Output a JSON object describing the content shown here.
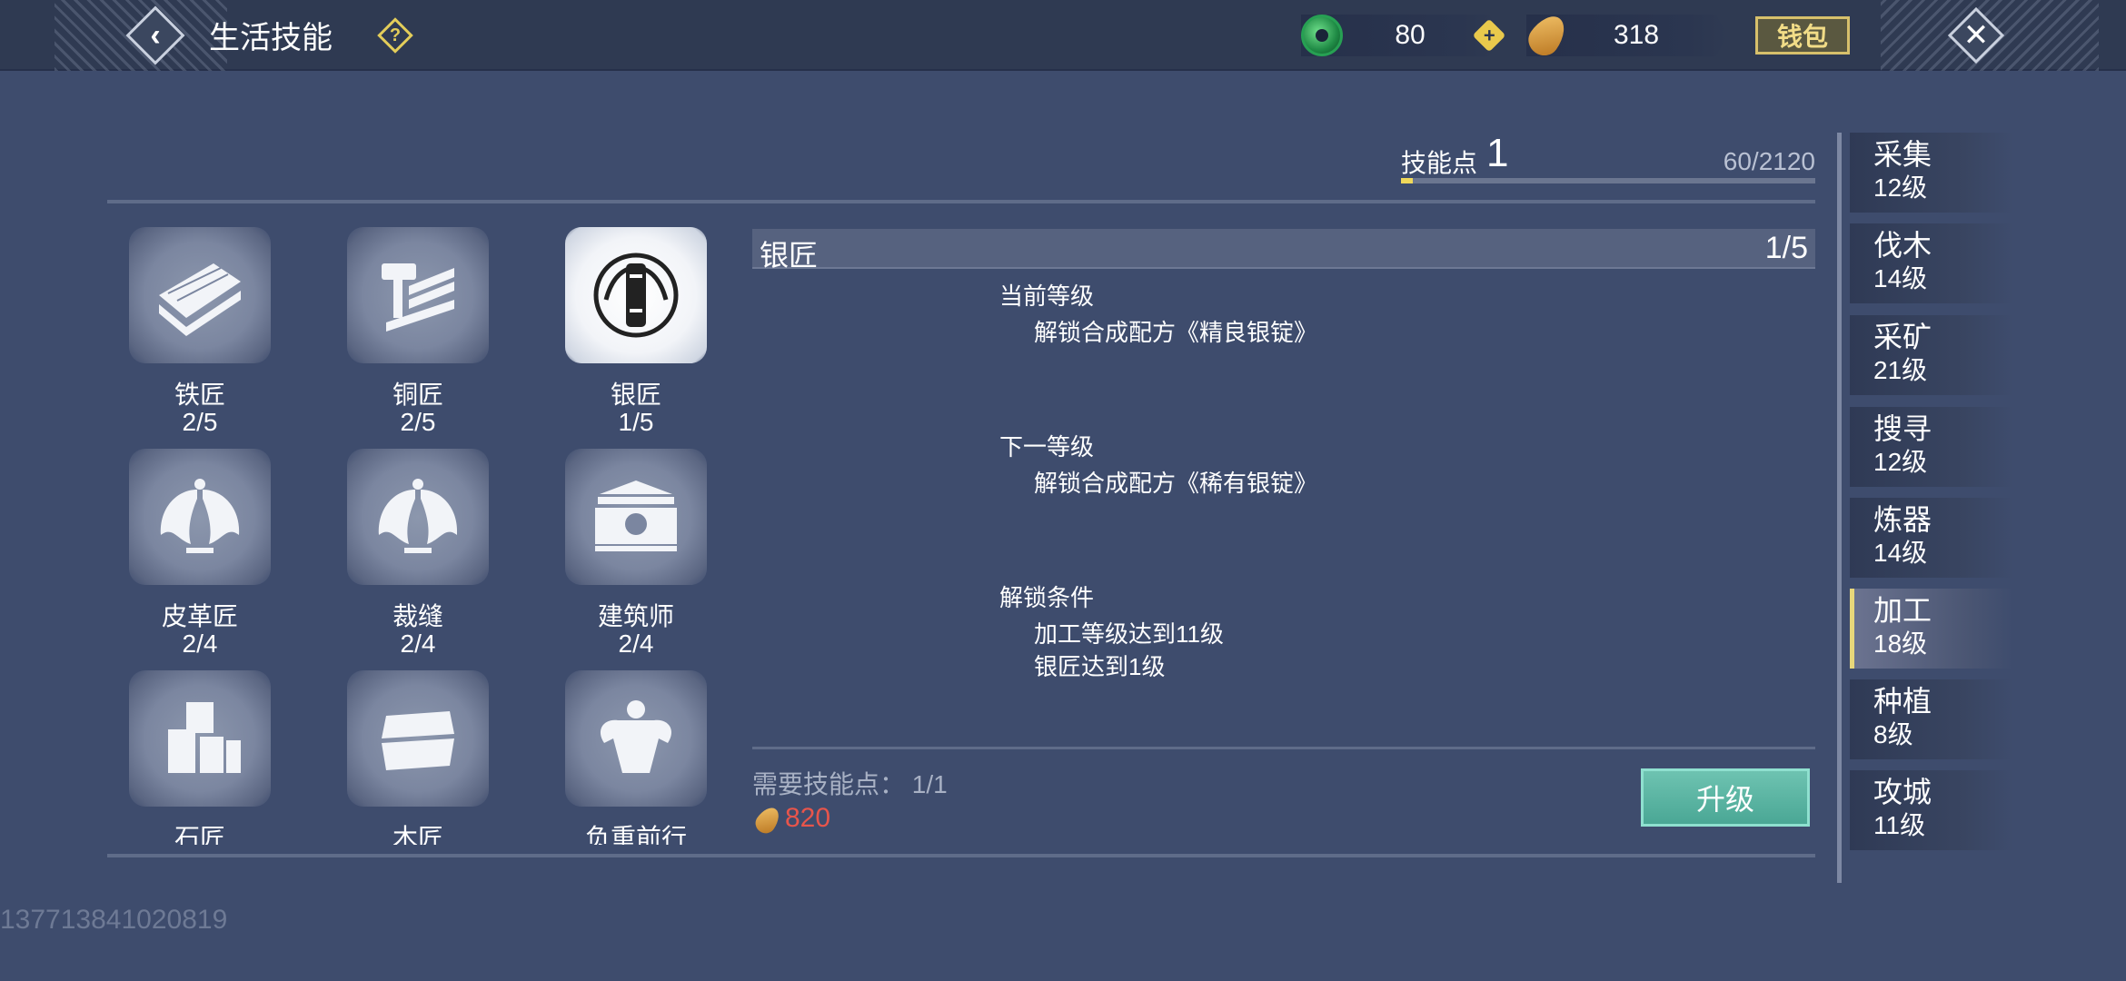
{
  "header": {
    "title": "生活技能",
    "help_label": "?",
    "jade_amount": "80",
    "seed_amount": "318",
    "wallet_label": "钱包"
  },
  "skill_points": {
    "label": "技能点",
    "value": "1",
    "progress_text": "60/2120",
    "progress_fraction": 0.028
  },
  "skills": [
    {
      "name": "铁匠",
      "level": "2/5",
      "icon": "lumber-icon"
    },
    {
      "name": "铜匠",
      "level": "2/5",
      "icon": "hammer-icon"
    },
    {
      "name": "银匠",
      "level": "1/5",
      "icon": "silver-ingot-icon",
      "selected": true
    },
    {
      "name": "皮革匠",
      "level": "2/4",
      "icon": "wings-icon"
    },
    {
      "name": "裁缝",
      "level": "2/4",
      "icon": "wings-icon"
    },
    {
      "name": "建筑师",
      "level": "2/4",
      "icon": "building-icon"
    },
    {
      "name": "石匠",
      "level": "",
      "icon": "stone-blocks-icon"
    },
    {
      "name": "木匠",
      "level": "",
      "icon": "wood-plank-icon"
    },
    {
      "name": "负重前行",
      "level": "",
      "icon": "strongman-icon"
    }
  ],
  "detail": {
    "name": "银匠",
    "level": "1/5",
    "current_title": "当前等级",
    "current_line": "解锁合成配方《精良银锭》",
    "next_title": "下一等级",
    "next_line": "解锁合成配方《稀有银锭》",
    "unlock_title": "解锁条件",
    "unlock_lines": [
      "加工等级达到11级",
      "银匠达到1级"
    ],
    "required_label": "需要技能点：  1/1",
    "cost": "820",
    "upgrade_label": "升级"
  },
  "categories": [
    {
      "name": "采集",
      "level": "12级"
    },
    {
      "name": "伐木",
      "level": "14级"
    },
    {
      "name": "采矿",
      "level": "21级"
    },
    {
      "name": "搜寻",
      "level": "12级"
    },
    {
      "name": "炼器",
      "level": "14级"
    },
    {
      "name": "加工",
      "level": "18级",
      "active": true
    },
    {
      "name": "种植",
      "level": "8级"
    },
    {
      "name": "攻城",
      "level": "11级"
    }
  ],
  "uid": "137713841020819",
  "colors": {
    "background": "#3e4c6d",
    "accent_yellow": "#e8d77a",
    "cost_red": "#e8554b",
    "upgrade_green": "#4aa795"
  }
}
